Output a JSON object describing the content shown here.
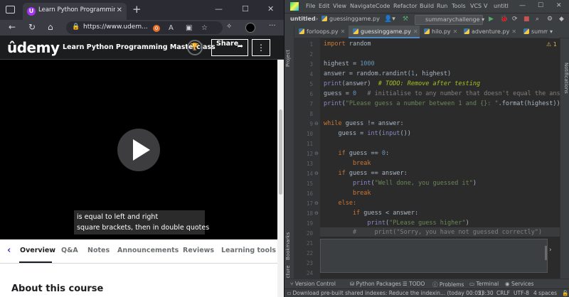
{
  "browser": {
    "tab_title": "Learn Python Programming Masterclass",
    "tab_close": "✕",
    "new_tab": "+",
    "url": "https://www.udem...",
    "ext_badge": "0",
    "udemy_logo": "ûdemy",
    "course_title": "Learn Python Programming Masterclass",
    "share_label": "Share",
    "more_label": "⋮",
    "caption_lines": [
      "is equal to left and right",
      "square brackets, then in double quotes"
    ],
    "nav_tabs": [
      "Overview",
      "Q&A",
      "Notes",
      "Announcements",
      "Reviews",
      "Learning tools"
    ],
    "about_heading": "About this course"
  },
  "ide": {
    "menu": [
      "File",
      "Edit",
      "View",
      "Navigate",
      "Code",
      "Refactor",
      "Build",
      "Run",
      "Tools",
      "VCS",
      "V",
      "untitl"
    ],
    "project": "untitled",
    "file": "guessinggame.py",
    "run_config": "summarychallenge",
    "tabs": [
      "forloops.py",
      "guessinggame.py",
      "hilo.py",
      "adventure.py",
      "summary"
    ],
    "warnings": "1",
    "left_strip": [
      "Project",
      "Bookmarks",
      "Structure"
    ],
    "right_strip": "Notifications",
    "tool_windows": [
      "Version Control",
      "Python Packages",
      "TODO",
      "Problems",
      "Terminal",
      "Services"
    ],
    "status_message": "Download pre-built shared indexes: Reduce the indexin... (today 00:05)",
    "status_pos": "23:30",
    "status_crlf": "CRLF",
    "status_enc": "UTF-8",
    "status_indent": "4 spaces"
  },
  "code": {
    "line_numbers": [
      "1",
      "2",
      "3",
      "4",
      "5",
      "6",
      "7",
      "8",
      "9",
      "10",
      "11",
      "12",
      "13",
      "14",
      "15",
      "16",
      "17",
      "18",
      "19",
      "20",
      "21",
      "22",
      "23",
      "24",
      "25",
      "26",
      "27"
    ],
    "l1_kw": "import",
    "l1_rest": " random",
    "l3_a": "highest = ",
    "l3_n": "1000",
    "l4_a": "answer = random.randint(",
    "l4_n": "1",
    "l4_b": ", highest)",
    "l5_fn": "print",
    "l5_a": "(answer)  ",
    "l5_todo": "# TODO: Remove after testing",
    "l6_a": "guess = ",
    "l6_n": "0",
    "l6_c": "   # initialise to any number that doesn't equal the answ",
    "l7_fn": "print",
    "l7_a": "(",
    "l7_s": "\"PLease guess a number between 1 and {}: \"",
    "l7_b": ".format(highest))",
    "l9_kw": "while",
    "l9_a": " guess != answer:",
    "l10_a": "    guess = ",
    "l10_fn": "int",
    "l10_b": "(",
    "l10_fn2": "input",
    "l10_c": "())",
    "l12_kw": "    if",
    "l12_a": " guess == ",
    "l12_n": "0",
    "l12_b": ":",
    "l13_kw": "        break",
    "l14_kw": "    if",
    "l14_a": " guess == answer:",
    "l15_fn": "        print",
    "l15_a": "(",
    "l15_s": "\"Well done, you guessed it\"",
    "l15_b": ")",
    "l16_kw": "        break",
    "l17_kw": "    else:",
    "l18_kw": "        if",
    "l18_a": " guess < answer:",
    "l19_fn": "            print",
    "l19_a": "(",
    "l19_s": "\"PLease guess higher\"",
    "l19_b": ")",
    "l20_c": "        #     print(\"Sorry, you have not guessed correctly\")"
  }
}
